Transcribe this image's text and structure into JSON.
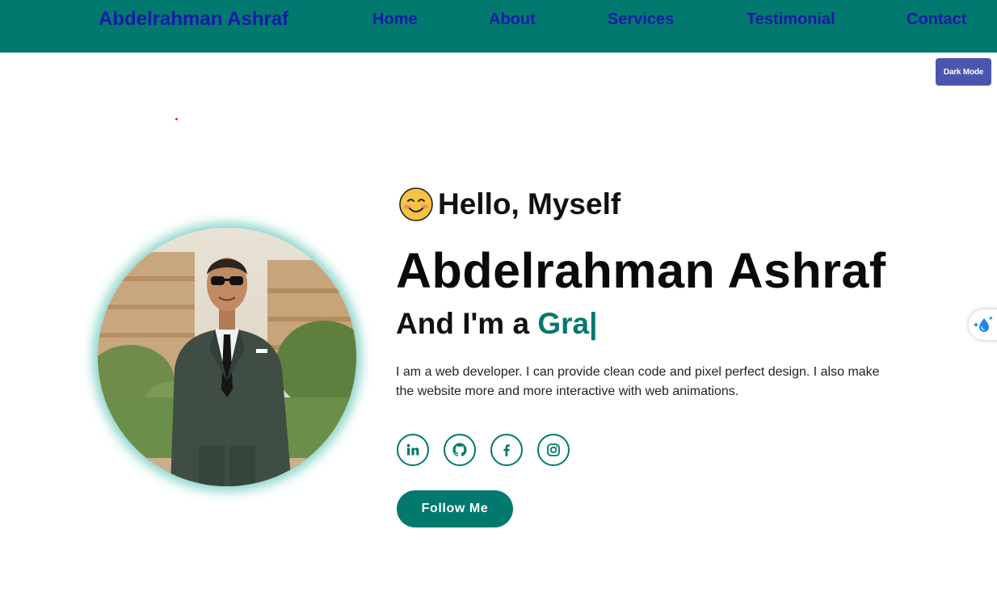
{
  "nav": {
    "brand": "Abdelrahman Ashraf",
    "links": [
      "Home",
      "About",
      "Services",
      "Testimonial",
      "Contact"
    ]
  },
  "dark_mode_label": "Dark Mode",
  "hero": {
    "greeting_emoji": "smiling-face-icon",
    "greeting": "Hello, Myself",
    "name": "Abdelrahman Ashraf",
    "role_prefix": "And I'm a ",
    "role_typed": "Gra|",
    "bio": "I am a web developer. I can provide clean code and pixel perfect design. I also make the website more and more interactive with web animations.",
    "socials": [
      "linkedin-icon",
      "github-icon",
      "facebook-icon",
      "instagram-icon"
    ],
    "follow_label": "Follow Me"
  },
  "colors": {
    "primary": "#01796f",
    "nav_link": "#1a1aa8",
    "dark_mode_button": "#4a55b0",
    "portrait_glow": "#5ec4b6"
  }
}
